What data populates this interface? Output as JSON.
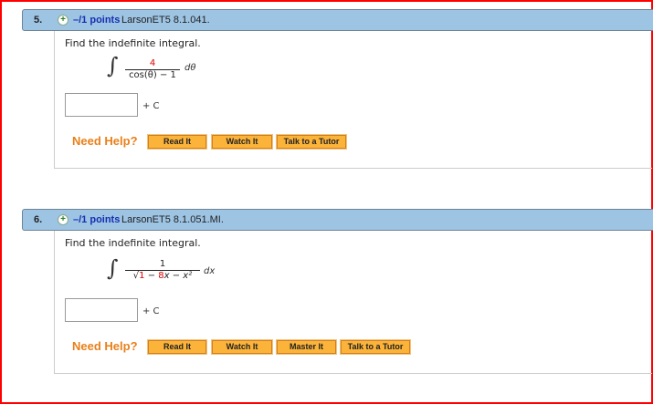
{
  "questions": [
    {
      "number": "5.",
      "points": "–/1 points",
      "ref": "LarsonET5 8.1.041.",
      "prompt": "Find the indefinite integral.",
      "numerator": "4",
      "denominator": "cos(θ) − 1",
      "differential": "dθ",
      "plus_c": "+ C",
      "help_label": "Need Help?",
      "buttons": [
        "Read It",
        "Watch It",
        "Talk to a Tutor"
      ]
    },
    {
      "number": "6.",
      "points": "–/1 points",
      "ref": "LarsonET5 8.1.051.MI.",
      "prompt": "Find the indefinite integral.",
      "numerator": "1",
      "rad_a": "1",
      "rad_b": " − ",
      "rad_c": "8",
      "rad_d": "x − x²",
      "differential": "dx",
      "plus_c": "+ C",
      "help_label": "Need Help?",
      "buttons": [
        "Read It",
        "Watch It",
        "Master It",
        "Talk to a Tutor"
      ]
    }
  ],
  "integral_sign": "∫",
  "sqrt_sign": "√"
}
